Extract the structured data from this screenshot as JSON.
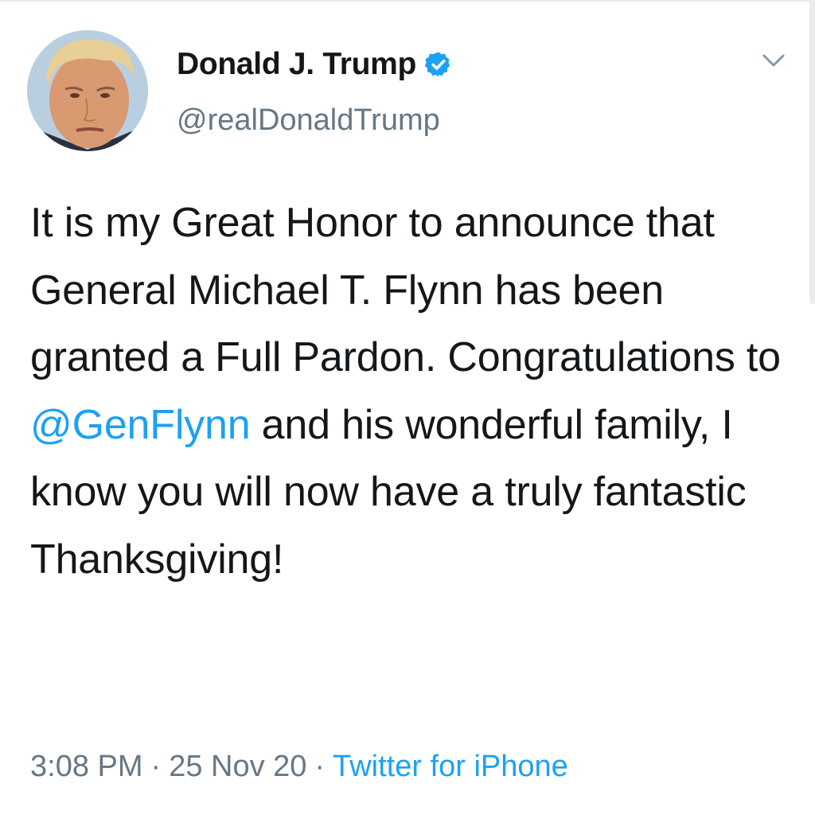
{
  "author": {
    "name": "Donald J. Trump",
    "handle": "@realDonaldTrump",
    "verified": true,
    "avatar_icon": "profile-photo"
  },
  "tweet": {
    "text_before": "It is my Great Honor to announce that General Michael T. Flynn has been granted a Full Pardon. Congratulations to ",
    "mention": "@GenFlynn",
    "text_after": " and his wonderful family, I know you will now have a truly fantastic Thanksgiving!"
  },
  "meta": {
    "time": "3:08 PM",
    "separator": "·",
    "date": "25 Nov 20",
    "source": "Twitter for iPhone"
  },
  "icons": {
    "verified": "verified-badge-icon",
    "menu": "chevron-down-icon"
  },
  "colors": {
    "link": "#1da1f2",
    "secondary_text": "#657786",
    "primary_text": "#14171a"
  }
}
